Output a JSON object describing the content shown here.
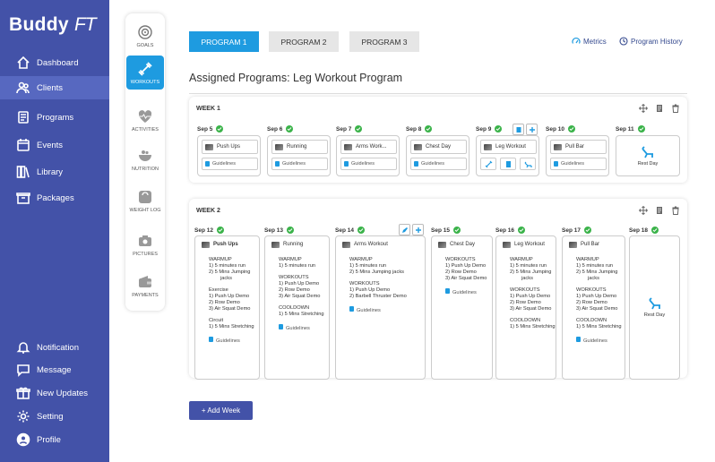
{
  "app": {
    "logo_text": "Buddy",
    "logo_suffix": "FT"
  },
  "sidebar": {
    "top": [
      {
        "label": "Dashboard"
      },
      {
        "label": "Clients"
      },
      {
        "label": "Programs"
      },
      {
        "label": "Events"
      },
      {
        "label": "Library"
      },
      {
        "label": "Packages"
      }
    ],
    "bottom": [
      {
        "label": "Notification"
      },
      {
        "label": "Message"
      },
      {
        "label": "New Updates"
      },
      {
        "label": "Setting"
      },
      {
        "label": "Profile"
      }
    ],
    "active": "Clients"
  },
  "subnav": [
    "GOALS",
    "WORKOUTS",
    "ACTIVITIES",
    "NUTRITION",
    "WEIGHT LOG",
    "PICTURES",
    "PAYMENTS"
  ],
  "tabs": [
    "PROGRAM 1",
    "PROGRAM 2",
    "PROGRAM 3"
  ],
  "links": {
    "metrics": "Metrics",
    "history": "Program History"
  },
  "assigned": "Assigned Programs:  Leg Workout Program",
  "week1": {
    "label": "WEEK 1",
    "days": [
      {
        "date": "Sep 5",
        "workout": "Push Ups",
        "guide": "Guidelines"
      },
      {
        "date": "Sep 6",
        "workout": "Running",
        "guide": "Guidelines"
      },
      {
        "date": "Sep 7",
        "workout": "Arms Work...",
        "guide": "Guidelines"
      },
      {
        "date": "Sep 8",
        "workout": "Chest Day",
        "guide": "Guidelines"
      },
      {
        "date": "Sep 9",
        "workout": "Leg Workout"
      },
      {
        "date": "Sep 10",
        "workout": "Pull Bar",
        "guide": "Guidelines"
      },
      {
        "date": "Sep 11",
        "rest": "Rest Day"
      }
    ]
  },
  "week2": {
    "label": "WEEK 2",
    "days": [
      {
        "date": "Sep 12",
        "workout": "Push Ups",
        "lines": [
          "WARMUP",
          "1) 5 minutes run",
          "2) 5 Mins Jumping",
          "jacks",
          "Exercise",
          "1) Push Up Demo",
          "2) Row Demo",
          "3) Air Squat Demo",
          "Circuit",
          "1) 5 Mins Stretching"
        ],
        "guide": "Guidelines"
      },
      {
        "date": "Sep 13",
        "workout": "Running",
        "lines": [
          "WARMUP",
          "1) 5 minutes run",
          "WORKOUTS",
          "1) Push Up Demo",
          "2) Row Demo",
          "3) Air Squat Demo",
          "COOLDOWN",
          "1) 5 Mins Stretching"
        ],
        "guide": "Guidelines"
      },
      {
        "date": "Sep 14",
        "workout": "Arms Workout",
        "lines": [
          "WARMUP",
          "1) 5 minutes run",
          "2) 5 Mins Jumping jacks",
          "WORKOUTS",
          "1) Push Up Demo",
          "2) Barbell Thruster Demo"
        ],
        "guide": "Guidelines"
      },
      {
        "date": "Sep 15",
        "workout": "Chest Day",
        "lines": [
          "WORKOUTS",
          "1) Push Up Demo",
          "2) Row Demo",
          "3) Air Squat Demo"
        ],
        "guide": "Guidelines"
      },
      {
        "date": "Sep 16",
        "workout": "Leg Workout",
        "lines": [
          "WARMUP",
          "1) 5 minutes run",
          "2) 5 Mins Jumping",
          "jacks",
          "WORKOUTS",
          "1) Push Up Demo",
          "2) Row Demo",
          "3) Air Squat Demo",
          "COOLDOWN",
          "1) 5 Mins Stretching"
        ]
      },
      {
        "date": "Sep 17",
        "workout": "Pull Bar",
        "lines": [
          "WARMUP",
          "1) 5 minutes run",
          "2) 5 Mins Jumping",
          "jacks",
          "WORKOUTS",
          "1) Push Up Demo",
          "2) Row Demo",
          "3) Air Squat Demo",
          "COOLDOWN",
          "1) 5 Mins Stretching"
        ],
        "guide": "Guidelines"
      },
      {
        "date": "Sep 18",
        "rest": "Rest Day"
      }
    ]
  },
  "add_week": "+ Add Week",
  "colors": {
    "sidebar": "#4352a8",
    "accent": "#1e9be0",
    "check": "#3bb34a"
  }
}
